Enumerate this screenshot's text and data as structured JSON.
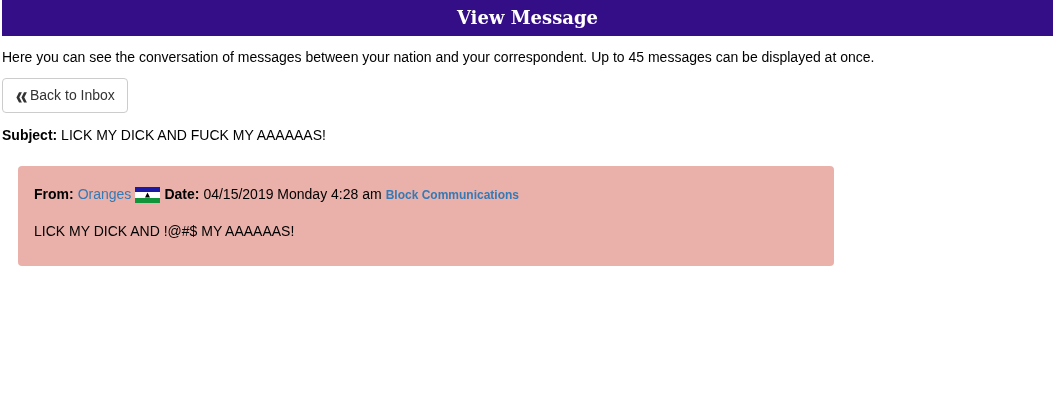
{
  "header": {
    "title": "View Message"
  },
  "intro": "Here you can see the conversation of messages between your nation and your correspondent. Up to 45 messages can be displayed at once.",
  "back_button": {
    "icon": "❰❰",
    "label": "Back to Inbox"
  },
  "subject": "**Subject:** LICK MY DICK AND FUCK MY AAAAAAS!",
  "messages": [
    {
      "from_label": "From:",
      "sender": "Oranges",
      "date_label": "Date:",
      "date": "04/15/2019 Monday 4:28 am",
      "action": "Block Communications",
      "body": "LICK MY DICK AND !@#$ MY AAAAAAS!"
    }
  ]
}
